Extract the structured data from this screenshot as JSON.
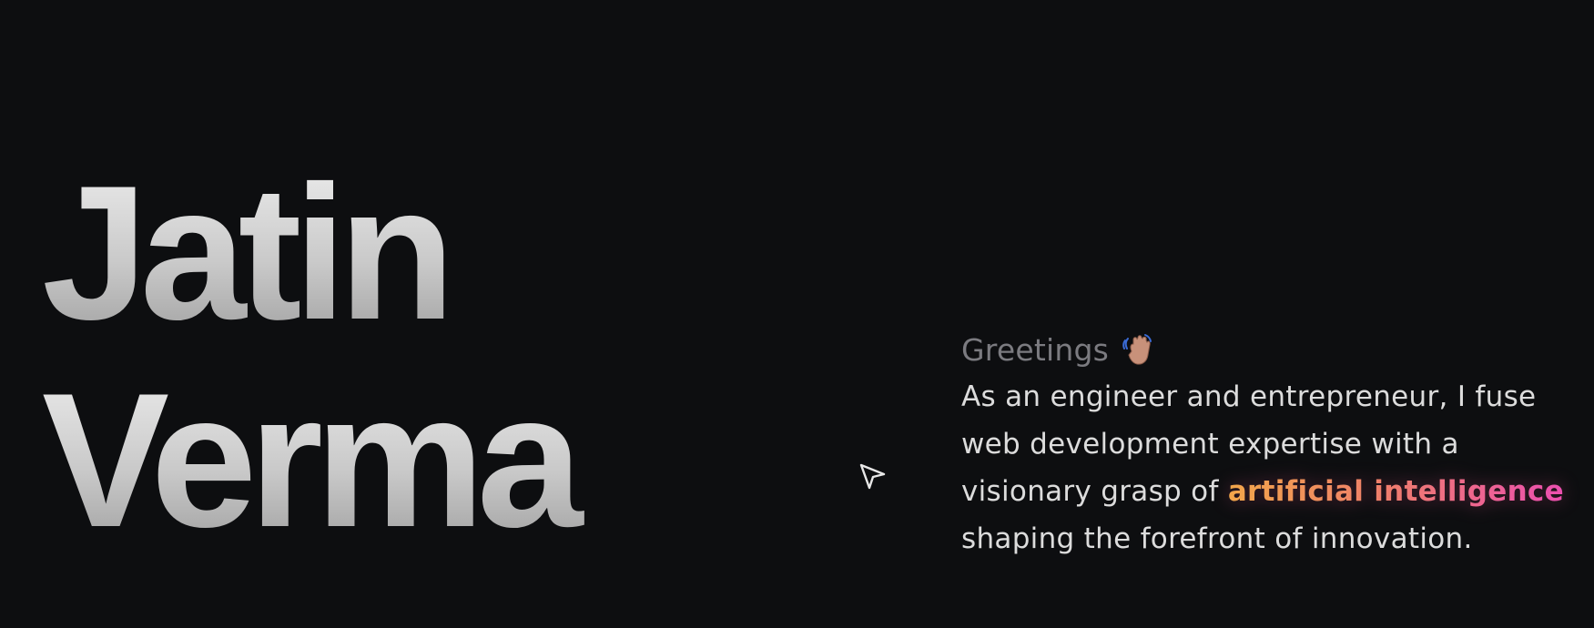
{
  "hero": {
    "first_name": "Jatin",
    "last_name": "Verma"
  },
  "intro": {
    "greeting": "Greetings",
    "greeting_icon": "waving-hand-icon",
    "bio_line_1": "As an engineer and entrepreneur, I fuse",
    "bio_line_2": "web development expertise with a",
    "bio_line_3_prefix": "visionary grasp of ",
    "bio_highlight": "artificial intelligence",
    "bio_line_4": "shaping the forefront of innovation."
  },
  "cursor": {
    "icon": "pointer-cursor-icon"
  },
  "colors": {
    "background": "#0d0e10",
    "highlight_start": "#f2a64a",
    "highlight_end": "#ec4fb0",
    "greeting": "#7b7b80",
    "body_text": "#dcdcdc"
  }
}
